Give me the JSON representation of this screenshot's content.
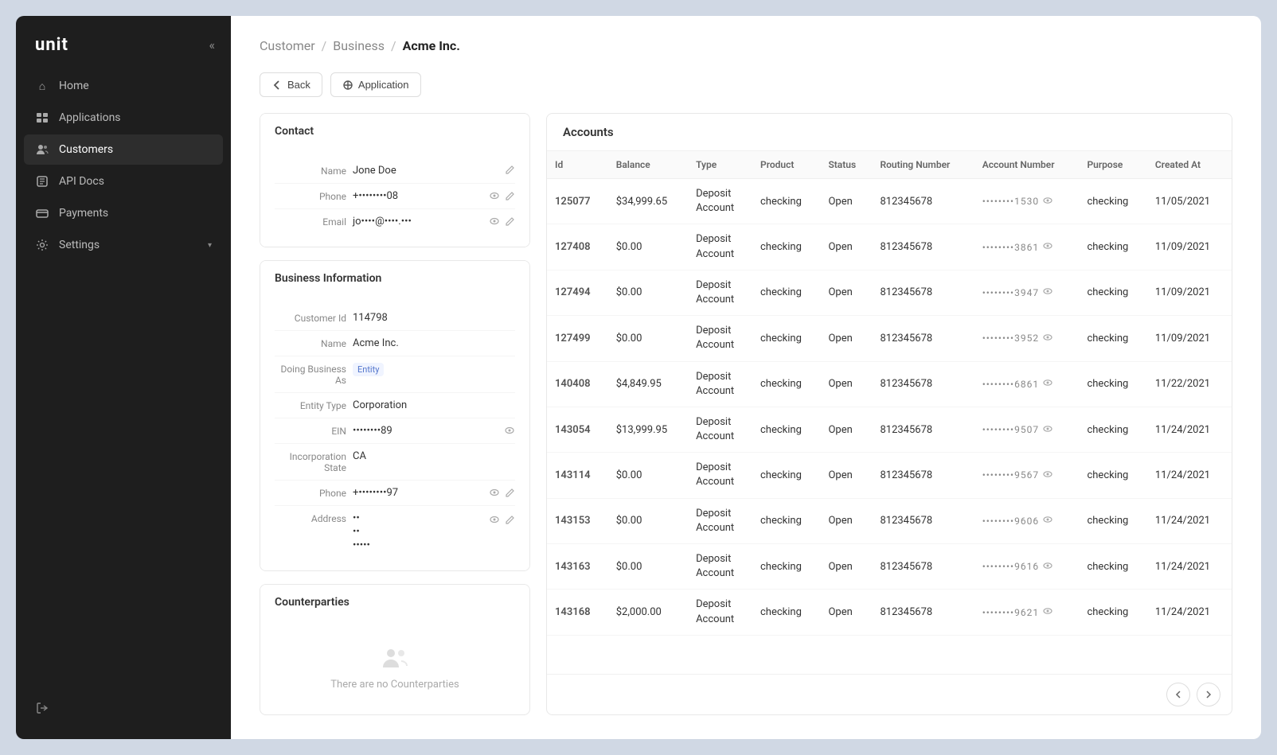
{
  "sidebar": {
    "logo": "unit",
    "collapse_title": "Collapse",
    "items": [
      {
        "id": "home",
        "label": "Home",
        "icon": "⌂"
      },
      {
        "id": "applications",
        "label": "Applications",
        "icon": "☰"
      },
      {
        "id": "customers",
        "label": "Customers",
        "icon": "👥"
      },
      {
        "id": "api-docs",
        "label": "API Docs",
        "icon": "☷"
      },
      {
        "id": "payments",
        "label": "Payments",
        "icon": "▶"
      },
      {
        "id": "settings",
        "label": "Settings",
        "icon": "⚙"
      }
    ],
    "bottom_item": {
      "label": "Logout",
      "icon": "⇥"
    }
  },
  "breadcrumb": {
    "parts": [
      "Customer",
      "Business",
      "Acme Inc."
    ]
  },
  "toolbar": {
    "back_label": "Back",
    "application_label": "Application"
  },
  "contact": {
    "title": "Contact",
    "name_label": "Name",
    "name_value": "Jone Doe",
    "phone_label": "Phone",
    "phone_value": "+••••••••08",
    "email_label": "Email",
    "email_value": "jo••••@••••.•••"
  },
  "business_info": {
    "title": "Business Information",
    "customer_id_label": "Customer Id",
    "customer_id_value": "114798",
    "name_label": "Name",
    "name_value": "Acme Inc.",
    "doing_label": "Doing Business As",
    "doing_value": "Entity",
    "entity_type_label": "Entity Type",
    "entity_type_value": "Corporation",
    "ein_label": "EIN",
    "ein_value": "••••••••89",
    "inc_state_label": "Incorporation State",
    "inc_state_value": "CA",
    "phone_label": "Phone",
    "phone_value": "+••••••••97",
    "address_label": "Address",
    "address_line1": "••",
    "address_line2": "••",
    "address_line3": "•••••"
  },
  "counterparties": {
    "title": "Counterparties",
    "empty_message": "There are no Counterparties"
  },
  "accounts": {
    "title": "Accounts",
    "columns": [
      "Id",
      "Balance",
      "Type",
      "Product",
      "Status",
      "Routing Number",
      "Account Number",
      "Purpose",
      "Created At"
    ],
    "rows": [
      {
        "id": "125077",
        "balance": "$34,999.65",
        "type": "Deposit Account",
        "product": "checking",
        "status": "Open",
        "routing": "812345678",
        "account_num": "••••••••1530",
        "purpose": "checking",
        "created": "11/05/2021"
      },
      {
        "id": "127408",
        "balance": "$0.00",
        "type": "Deposit Account",
        "product": "checking",
        "status": "Open",
        "routing": "812345678",
        "account_num": "••••••••3861",
        "purpose": "checking",
        "created": "11/09/2021"
      },
      {
        "id": "127494",
        "balance": "$0.00",
        "type": "Deposit Account",
        "product": "checking",
        "status": "Open",
        "routing": "812345678",
        "account_num": "••••••••3947",
        "purpose": "checking",
        "created": "11/09/2021"
      },
      {
        "id": "127499",
        "balance": "$0.00",
        "type": "Deposit Account",
        "product": "checking",
        "status": "Open",
        "routing": "812345678",
        "account_num": "••••••••3952",
        "purpose": "checking",
        "created": "11/09/2021"
      },
      {
        "id": "140408",
        "balance": "$4,849.95",
        "type": "Deposit Account",
        "product": "checking",
        "status": "Open",
        "routing": "812345678",
        "account_num": "••••••••6861",
        "purpose": "checking",
        "created": "11/22/2021"
      },
      {
        "id": "143054",
        "balance": "$13,999.95",
        "type": "Deposit Account",
        "product": "checking",
        "status": "Open",
        "routing": "812345678",
        "account_num": "••••••••9507",
        "purpose": "checking",
        "created": "11/24/2021"
      },
      {
        "id": "143114",
        "balance": "$0.00",
        "type": "Deposit Account",
        "product": "checking",
        "status": "Open",
        "routing": "812345678",
        "account_num": "••••••••9567",
        "purpose": "checking",
        "created": "11/24/2021"
      },
      {
        "id": "143153",
        "balance": "$0.00",
        "type": "Deposit Account",
        "product": "checking",
        "status": "Open",
        "routing": "812345678",
        "account_num": "••••••••9606",
        "purpose": "checking",
        "created": "11/24/2021"
      },
      {
        "id": "143163",
        "balance": "$0.00",
        "type": "Deposit Account",
        "product": "checking",
        "status": "Open",
        "routing": "812345678",
        "account_num": "••••••••9616",
        "purpose": "checking",
        "created": "11/24/2021"
      },
      {
        "id": "143168",
        "balance": "$2,000.00",
        "type": "Deposit Account",
        "product": "checking",
        "status": "Open",
        "routing": "812345678",
        "account_num": "••••••••9621",
        "purpose": "checking",
        "created": "11/24/2021"
      }
    ]
  }
}
